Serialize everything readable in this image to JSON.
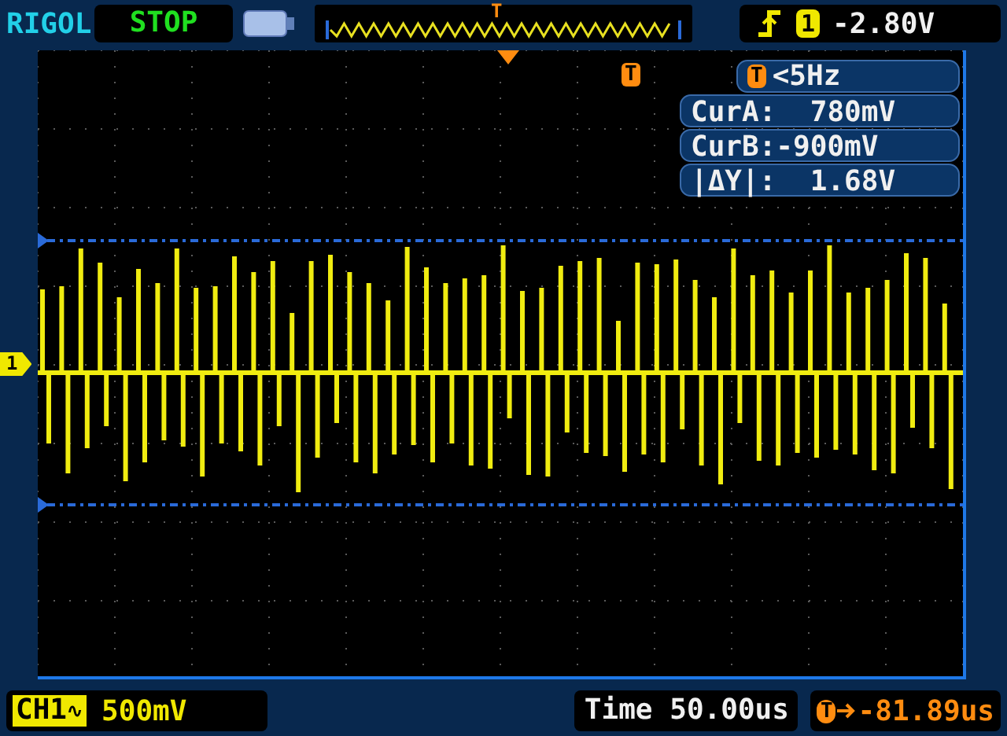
{
  "brand": "RIGOL",
  "run_state": "STOP",
  "memory_view": {
    "trigger_marker": "T"
  },
  "trigger": {
    "rising_edge": true,
    "source": "1",
    "level": "-2.80V"
  },
  "display": {
    "trigger_marker": "T",
    "channel_marker": "1",
    "info": {
      "trigger_marker": "T",
      "frequency": "<5Hz",
      "rows": [
        {
          "text": "CurA:  780mV"
        },
        {
          "text": "CurB:-900mV"
        },
        {
          "text": "|ΔY|:  1.68V"
        }
      ]
    }
  },
  "status_bar": {
    "channel": "CH1",
    "coupling": "∿",
    "scale": "500mV",
    "timebase": "Time 50.00us",
    "trigger_offset_marker": "T",
    "trigger_offset": "-81.89us"
  }
}
